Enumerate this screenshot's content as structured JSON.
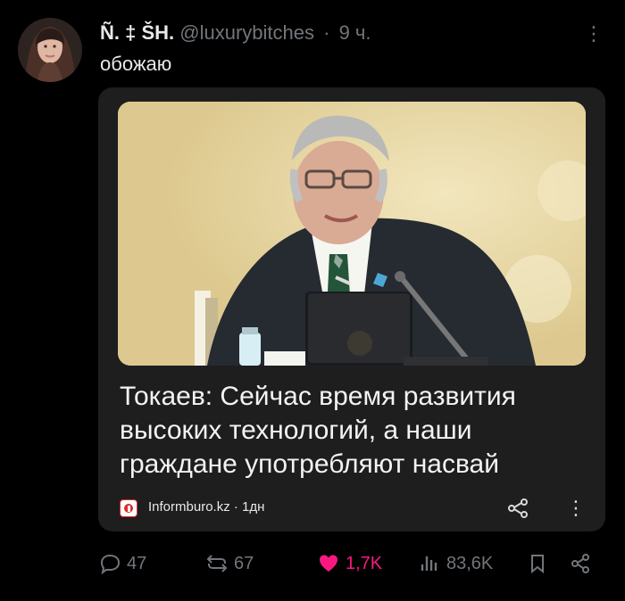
{
  "post": {
    "display_name": "Ñ. ‡ ŠH.",
    "handle": "@luxurybitches",
    "separator": "·",
    "time": "9 ч.",
    "text": "обожаю",
    "more_glyph": "⋮",
    "avatar_icon": "profile-avatar"
  },
  "link_card": {
    "headline": "Токаев: Сейчас время развития высоких технологий, а наши граждане употребляют насвай",
    "source": "Informburo.kz · 1дн",
    "more_glyph": "⋮",
    "image_icon": "news-photo"
  },
  "actions": {
    "replies": "47",
    "reposts": "67",
    "likes": "1,7K",
    "views": "83,6K"
  },
  "colors": {
    "background": "#000000",
    "text": "#e7e9ea",
    "muted": "#71767b",
    "like": "#f91880",
    "card": "#1e1e1e",
    "source_brand": "#dd2b2b"
  }
}
